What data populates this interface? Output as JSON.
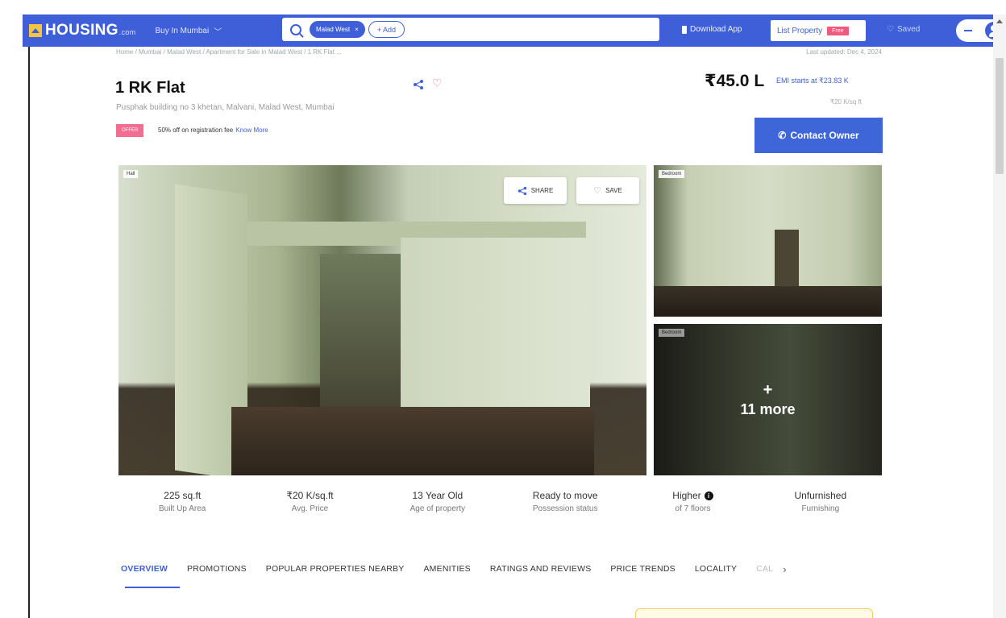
{
  "topbar": {
    "logo_text": "HOUSING",
    "logo_tld": ".com",
    "buy_in": "Buy In Mumbai",
    "search_chip": "Malad West",
    "add_chip": "+ Add",
    "download_app": "Download App",
    "list_property": "List Property",
    "free_badge": "Free",
    "saved": "Saved",
    "brand_color": "#3f5fd9"
  },
  "header": {
    "breadcrumb": "Home / Mumbai / Malad West / Apartment for Sale in Malad West / 1 RK Flat ...",
    "last_updated": "Last updated: Dec 4, 2024",
    "title": "1 RK Flat",
    "address": "Pusphak building no 3 khetan, Malvani, Malad West, Mumbai",
    "offer_badge": "OFFER",
    "offer_text": "50% off on registration fee",
    "offer_link": "Know More"
  },
  "pricing": {
    "price": "₹45.0 L",
    "emi": "EMI starts at ₹23.83 K",
    "per_sqft": "₹20 K/sq ft",
    "contact_button": "Contact Owner"
  },
  "gallery": {
    "main_tag": "Hall",
    "share_label": "SHARE",
    "save_label": "SAVE",
    "bed1_tag": "Bedroom",
    "bed2_tag": "Bedroom",
    "more_plus": "+",
    "more_label": "11 more"
  },
  "stats": [
    {
      "value": "225 sq.ft",
      "label": "Built Up Area"
    },
    {
      "value": "₹20 K/sq.ft",
      "label": "Avg. Price"
    },
    {
      "value": "13 Year Old",
      "label": "Age of property"
    },
    {
      "value": "Ready to move",
      "label": "Possession status"
    },
    {
      "value": "Higher",
      "label": "of 7 floors"
    },
    {
      "value": "Unfurnished",
      "label": "Furnishing"
    }
  ],
  "tabs": [
    "OVERVIEW",
    "PROMOTIONS",
    "POPULAR PROPERTIES NEARBY",
    "AMENITIES",
    "RATINGS AND REVIEWS",
    "PRICE TRENDS",
    "LOCALITY",
    "CAL"
  ]
}
